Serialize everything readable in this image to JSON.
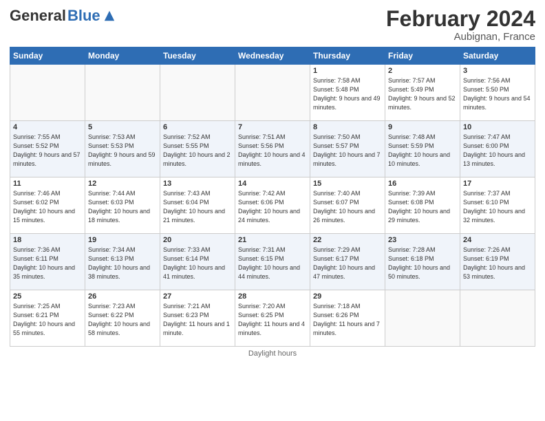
{
  "header": {
    "logo_general": "General",
    "logo_blue": "Blue",
    "month_title": "February 2024",
    "subtitle": "Aubignan, France"
  },
  "footer": {
    "daylight_label": "Daylight hours"
  },
  "days_of_week": [
    "Sunday",
    "Monday",
    "Tuesday",
    "Wednesday",
    "Thursday",
    "Friday",
    "Saturday"
  ],
  "weeks": [
    {
      "days": [
        {
          "num": "",
          "info": ""
        },
        {
          "num": "",
          "info": ""
        },
        {
          "num": "",
          "info": ""
        },
        {
          "num": "",
          "info": ""
        },
        {
          "num": "1",
          "info": "Sunrise: 7:58 AM\nSunset: 5:48 PM\nDaylight: 9 hours and 49 minutes."
        },
        {
          "num": "2",
          "info": "Sunrise: 7:57 AM\nSunset: 5:49 PM\nDaylight: 9 hours and 52 minutes."
        },
        {
          "num": "3",
          "info": "Sunrise: 7:56 AM\nSunset: 5:50 PM\nDaylight: 9 hours and 54 minutes."
        }
      ]
    },
    {
      "days": [
        {
          "num": "4",
          "info": "Sunrise: 7:55 AM\nSunset: 5:52 PM\nDaylight: 9 hours and 57 minutes."
        },
        {
          "num": "5",
          "info": "Sunrise: 7:53 AM\nSunset: 5:53 PM\nDaylight: 9 hours and 59 minutes."
        },
        {
          "num": "6",
          "info": "Sunrise: 7:52 AM\nSunset: 5:55 PM\nDaylight: 10 hours and 2 minutes."
        },
        {
          "num": "7",
          "info": "Sunrise: 7:51 AM\nSunset: 5:56 PM\nDaylight: 10 hours and 4 minutes."
        },
        {
          "num": "8",
          "info": "Sunrise: 7:50 AM\nSunset: 5:57 PM\nDaylight: 10 hours and 7 minutes."
        },
        {
          "num": "9",
          "info": "Sunrise: 7:48 AM\nSunset: 5:59 PM\nDaylight: 10 hours and 10 minutes."
        },
        {
          "num": "10",
          "info": "Sunrise: 7:47 AM\nSunset: 6:00 PM\nDaylight: 10 hours and 13 minutes."
        }
      ]
    },
    {
      "days": [
        {
          "num": "11",
          "info": "Sunrise: 7:46 AM\nSunset: 6:02 PM\nDaylight: 10 hours and 15 minutes."
        },
        {
          "num": "12",
          "info": "Sunrise: 7:44 AM\nSunset: 6:03 PM\nDaylight: 10 hours and 18 minutes."
        },
        {
          "num": "13",
          "info": "Sunrise: 7:43 AM\nSunset: 6:04 PM\nDaylight: 10 hours and 21 minutes."
        },
        {
          "num": "14",
          "info": "Sunrise: 7:42 AM\nSunset: 6:06 PM\nDaylight: 10 hours and 24 minutes."
        },
        {
          "num": "15",
          "info": "Sunrise: 7:40 AM\nSunset: 6:07 PM\nDaylight: 10 hours and 26 minutes."
        },
        {
          "num": "16",
          "info": "Sunrise: 7:39 AM\nSunset: 6:08 PM\nDaylight: 10 hours and 29 minutes."
        },
        {
          "num": "17",
          "info": "Sunrise: 7:37 AM\nSunset: 6:10 PM\nDaylight: 10 hours and 32 minutes."
        }
      ]
    },
    {
      "days": [
        {
          "num": "18",
          "info": "Sunrise: 7:36 AM\nSunset: 6:11 PM\nDaylight: 10 hours and 35 minutes."
        },
        {
          "num": "19",
          "info": "Sunrise: 7:34 AM\nSunset: 6:13 PM\nDaylight: 10 hours and 38 minutes."
        },
        {
          "num": "20",
          "info": "Sunrise: 7:33 AM\nSunset: 6:14 PM\nDaylight: 10 hours and 41 minutes."
        },
        {
          "num": "21",
          "info": "Sunrise: 7:31 AM\nSunset: 6:15 PM\nDaylight: 10 hours and 44 minutes."
        },
        {
          "num": "22",
          "info": "Sunrise: 7:29 AM\nSunset: 6:17 PM\nDaylight: 10 hours and 47 minutes."
        },
        {
          "num": "23",
          "info": "Sunrise: 7:28 AM\nSunset: 6:18 PM\nDaylight: 10 hours and 50 minutes."
        },
        {
          "num": "24",
          "info": "Sunrise: 7:26 AM\nSunset: 6:19 PM\nDaylight: 10 hours and 53 minutes."
        }
      ]
    },
    {
      "days": [
        {
          "num": "25",
          "info": "Sunrise: 7:25 AM\nSunset: 6:21 PM\nDaylight: 10 hours and 55 minutes."
        },
        {
          "num": "26",
          "info": "Sunrise: 7:23 AM\nSunset: 6:22 PM\nDaylight: 10 hours and 58 minutes."
        },
        {
          "num": "27",
          "info": "Sunrise: 7:21 AM\nSunset: 6:23 PM\nDaylight: 11 hours and 1 minute."
        },
        {
          "num": "28",
          "info": "Sunrise: 7:20 AM\nSunset: 6:25 PM\nDaylight: 11 hours and 4 minutes."
        },
        {
          "num": "29",
          "info": "Sunrise: 7:18 AM\nSunset: 6:26 PM\nDaylight: 11 hours and 7 minutes."
        },
        {
          "num": "",
          "info": ""
        },
        {
          "num": "",
          "info": ""
        }
      ]
    }
  ]
}
